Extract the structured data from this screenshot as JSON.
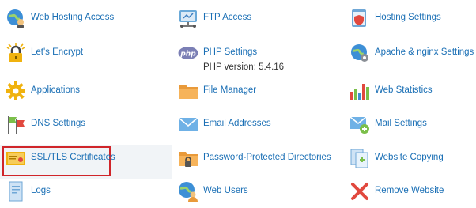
{
  "items": {
    "web_hosting_access": {
      "label": "Web Hosting Access",
      "icon": "globe-user-icon"
    },
    "ftp_access": {
      "label": "FTP Access",
      "icon": "ftp-folder-icon"
    },
    "hosting_settings": {
      "label": "Hosting Settings",
      "icon": "hosting-settings-icon"
    },
    "lets_encrypt": {
      "label": "Let's Encrypt",
      "icon": "lock-icon"
    },
    "php_settings": {
      "label": "PHP Settings",
      "sub": "PHP version: 5.4.16",
      "icon": "php-icon"
    },
    "apache_nginx": {
      "label": "Apache & nginx Settings",
      "icon": "apache-settings-icon"
    },
    "applications": {
      "label": "Applications",
      "icon": "gear-icon"
    },
    "file_manager": {
      "label": "File Manager",
      "icon": "folder-icon"
    },
    "web_statistics": {
      "label": "Web Statistics",
      "icon": "bar-chart-icon"
    },
    "dns_settings": {
      "label": "DNS Settings",
      "icon": "flags-icon"
    },
    "email_addresses": {
      "label": "Email Addresses",
      "icon": "envelope-icon"
    },
    "mail_settings": {
      "label": "Mail Settings",
      "icon": "mail-settings-icon"
    },
    "ssl_tls": {
      "label": "SSL/TLS Certificates",
      "icon": "certificate-icon"
    },
    "password_dirs": {
      "label": "Password-Protected Directories",
      "icon": "locked-folder-icon"
    },
    "website_copying": {
      "label": "Website Copying",
      "icon": "copy-pages-icon"
    },
    "logs": {
      "label": "Logs",
      "icon": "log-document-icon"
    },
    "web_users": {
      "label": "Web Users",
      "icon": "web-users-icon"
    },
    "remove_website": {
      "label": "Remove Website",
      "icon": "red-x-icon"
    }
  },
  "colors": {
    "link": "#1a6fb5",
    "highlight_border": "#d0252a",
    "highlight_bg": "#f1f4f7"
  }
}
